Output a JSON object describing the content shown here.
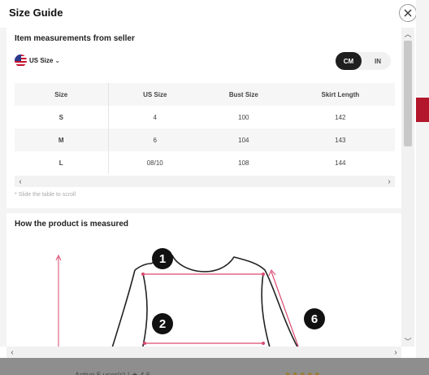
{
  "modal": {
    "title": "Size Guide",
    "close_icon": "close-icon"
  },
  "measurements": {
    "section_title": "Item measurements from seller",
    "size_system": "US Size",
    "units": [
      "CM",
      "IN"
    ],
    "selected_unit": "CM",
    "table": {
      "headers": [
        "Size",
        "US Size",
        "Bust Size",
        "Skirt Length"
      ],
      "rows": [
        [
          "S",
          "4",
          "100",
          "142"
        ],
        [
          "M",
          "6",
          "104",
          "143"
        ],
        [
          "L",
          "08/10",
          "108",
          "144"
        ]
      ]
    },
    "scroll_hint": "* Slide the table to scroll"
  },
  "how_measured": {
    "section_title": "How the product is measured",
    "markers": [
      "1",
      "2",
      "6"
    ]
  },
  "colors": {
    "accent_dark": "#1f1f1f",
    "measure_line": "#d94a6e",
    "background_cta": "#b3172b"
  }
}
